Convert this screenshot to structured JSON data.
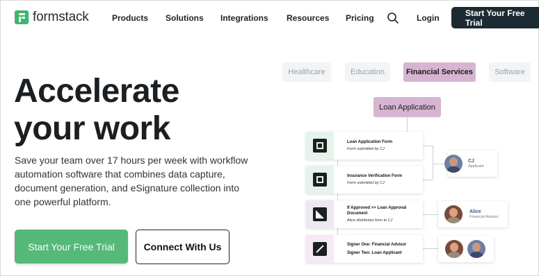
{
  "brand": {
    "name": "formstack",
    "accent": "#3fb56e",
    "dark": "#1c2a33",
    "highlight": "#d7b5d2"
  },
  "nav": {
    "items": [
      "Products",
      "Solutions",
      "Integrations",
      "Resources",
      "Pricing"
    ],
    "search_icon": "search-icon",
    "login": "Login",
    "cta": "Start Your Free Trial"
  },
  "hero": {
    "title_line1": "Accelerate",
    "title_line2": "your work",
    "description": "Save your team over 17 hours per week with workflow automation software that combines data capture, document generation, and eSignature collection into one powerful platform.",
    "primary_button": "Start Your Free Trial",
    "secondary_button": "Connect With Us"
  },
  "illustration": {
    "tabs": [
      "Healthcare",
      "Education",
      "Financial Services",
      "Software"
    ],
    "active_tab": "Financial Services",
    "workflow_label": "Loan Application",
    "steps": [
      {
        "title": "Loan Application Form",
        "subtitle": "Form submitted by CJ",
        "icon": "form-icon"
      },
      {
        "title": "Insurance Verification Form",
        "subtitle": "Form submitted by CJ",
        "icon": "form-icon"
      },
      {
        "title": "If Approved >> Loan Approval Document",
        "subtitle": "Alice distributes form to CJ",
        "icon": "document-icon"
      },
      {
        "title": "Signer One: Financial Advisor",
        "subtitle": "Signer Two: Loan Applicant",
        "icon": "pen-icon"
      }
    ],
    "people": [
      {
        "name": "CJ",
        "role": "Applicant"
      },
      {
        "name": "Alice",
        "role": "Financial Advisor"
      }
    ]
  }
}
